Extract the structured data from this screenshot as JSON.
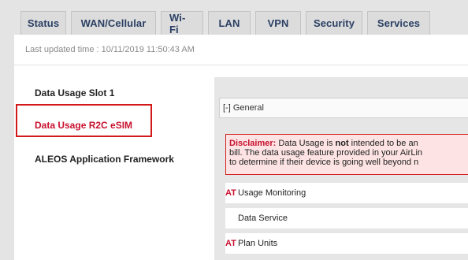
{
  "tabs": [
    "Status",
    "WAN/Cellular",
    "Wi-Fi",
    "LAN",
    "VPN",
    "Security",
    "Services"
  ],
  "last_updated": "Last updated time : 10/11/2019 11:50:43 AM",
  "nav": {
    "items": [
      "Data Usage Slot 1",
      "Data Usage R2C eSIM",
      "ALEOS Application Framework"
    ],
    "active_index": 1
  },
  "general_section": "[-] General",
  "disclaimer": {
    "label": "Disclaimer:",
    "line1_pre": " Data Usage is ",
    "line1_bold": "not",
    "line1_post": " intended to be an",
    "line2": "bill. The data usage feature provided in your AirLin",
    "line3": "to determine if their device is going well beyond n"
  },
  "rows": [
    {
      "at": "AT",
      "label": "Usage Monitoring"
    },
    {
      "at": "",
      "label": "Data Service"
    },
    {
      "at": "AT",
      "label": "Plan Units"
    }
  ],
  "colors": {
    "accent_red": "#c8102e",
    "tab_text": "#2a3f63",
    "disclaimer_bg": "#fde3e3"
  }
}
